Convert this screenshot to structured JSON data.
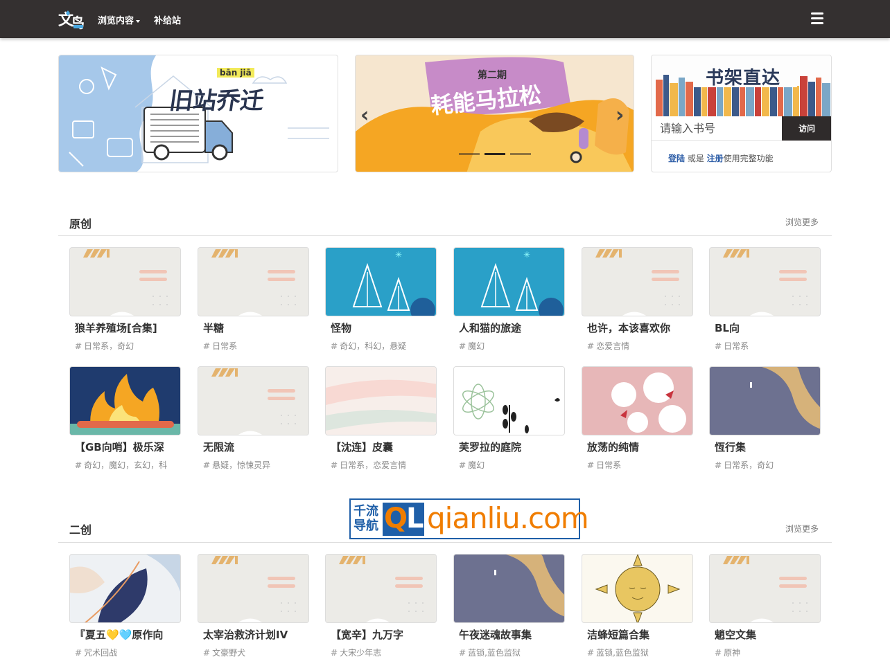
{
  "nav": {
    "browse_label": "浏览内容",
    "supply_label": "补给站"
  },
  "banners": {
    "left": {
      "title": "旧站乔迁",
      "pinyin": "bān jiā"
    },
    "mid": {
      "issue": "第二期",
      "title": "耗能马拉松",
      "active_slide": 2,
      "slide_count": 3
    },
    "right": {
      "title": "书架直达",
      "input_placeholder": "请输入书号",
      "visit_label": "访问",
      "login_label": "登陆",
      "or_text": " 或是 ",
      "register_label": "注册",
      "suffix_text": "使用完整功能"
    }
  },
  "colors": {
    "nav_bg": "#343030",
    "link_blue": "#2f5fa8",
    "accent_orange": "#f5a623"
  },
  "sections": [
    {
      "title": "原创",
      "more_label": "浏览更多",
      "books": [
        {
          "title": "狼羊养殖场[合集]",
          "tags": "日常系，奇幻",
          "cover": "default"
        },
        {
          "title": "半糖",
          "tags": "日常系",
          "cover": "default"
        },
        {
          "title": "怪物",
          "tags": "奇幻，科幻，悬疑",
          "cover": "winter"
        },
        {
          "title": "人和猫的旅途",
          "tags": "魔幻",
          "cover": "winter"
        },
        {
          "title": "也许，本该喜欢你",
          "tags": "恋爱言情",
          "cover": "default"
        },
        {
          "title": "BL向",
          "tags": "日常系",
          "cover": "default"
        },
        {
          "title": "【GB向哨】极乐深",
          "tags": "奇幻，魔幻，玄幻，科",
          "cover": "fire"
        },
        {
          "title": "无限流",
          "tags": "悬疑，惊悚灵异",
          "cover": "default"
        },
        {
          "title": "【沈连】皮囊",
          "tags": "日常系，恋爱言情",
          "cover": "pastel"
        },
        {
          "title": "芙罗拉的庭院",
          "tags": "魔幻",
          "cover": "plant"
        },
        {
          "title": "放荡的纯情",
          "tags": "日常系",
          "cover": "blossom"
        },
        {
          "title": "恆行集",
          "tags": "日常系，奇幻",
          "cover": "slate"
        }
      ]
    },
    {
      "title": "二创",
      "more_label": "浏览更多",
      "books": [
        {
          "title": "『夏五💛🩵原作向",
          "tags": "咒术回战",
          "cover": "leaves"
        },
        {
          "title": "太宰治救济计划IV",
          "tags": "文豪野犬",
          "cover": "default"
        },
        {
          "title": "【宽辛】九万字",
          "tags": "大宋少年志",
          "cover": "default"
        },
        {
          "title": "午夜迷魂故事集",
          "tags": "蓝锁,蓝色监狱",
          "cover": "slate"
        },
        {
          "title": "洁蜂短篇合集",
          "tags": "蓝锁,蓝色监狱",
          "cover": "sun"
        },
        {
          "title": "魈空文集",
          "tags": "原神",
          "cover": "default"
        }
      ]
    }
  ],
  "watermark": {
    "cn_line1": "千流",
    "cn_line2": "导航",
    "ql": "QL",
    "url": "qianliu.com"
  },
  "icons": {
    "logo": "site-logo-icon",
    "menu": "hamburger-menu-icon",
    "tag": "hash-icon",
    "prev": "chevron-left-icon",
    "next": "chevron-right-icon"
  }
}
